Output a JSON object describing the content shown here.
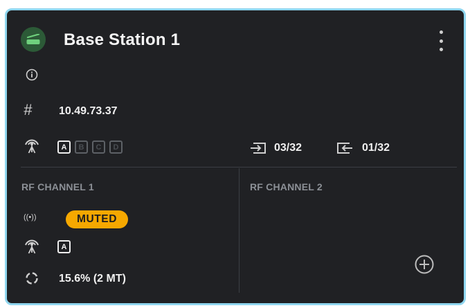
{
  "device": {
    "name": "Base Station 1",
    "ip": "10.49.73.37",
    "channels": [
      "A",
      "B",
      "C",
      "D"
    ],
    "active_channel": "A",
    "inputs": "03/32",
    "outputs": "01/32",
    "accent_color": "#2c5a37",
    "icon": "base-station-icon"
  },
  "rf_channel_1": {
    "label": "RF CHANNEL 1",
    "status": "MUTED",
    "status_color": "#f6a800",
    "antenna": "A",
    "usage": "15.6% (2 MT)",
    "usage_fraction": 0.156
  },
  "rf_channel_2": {
    "label": "RF CHANNEL 2"
  },
  "colors": {
    "border": "#8fd6ef",
    "background": "#202124"
  }
}
